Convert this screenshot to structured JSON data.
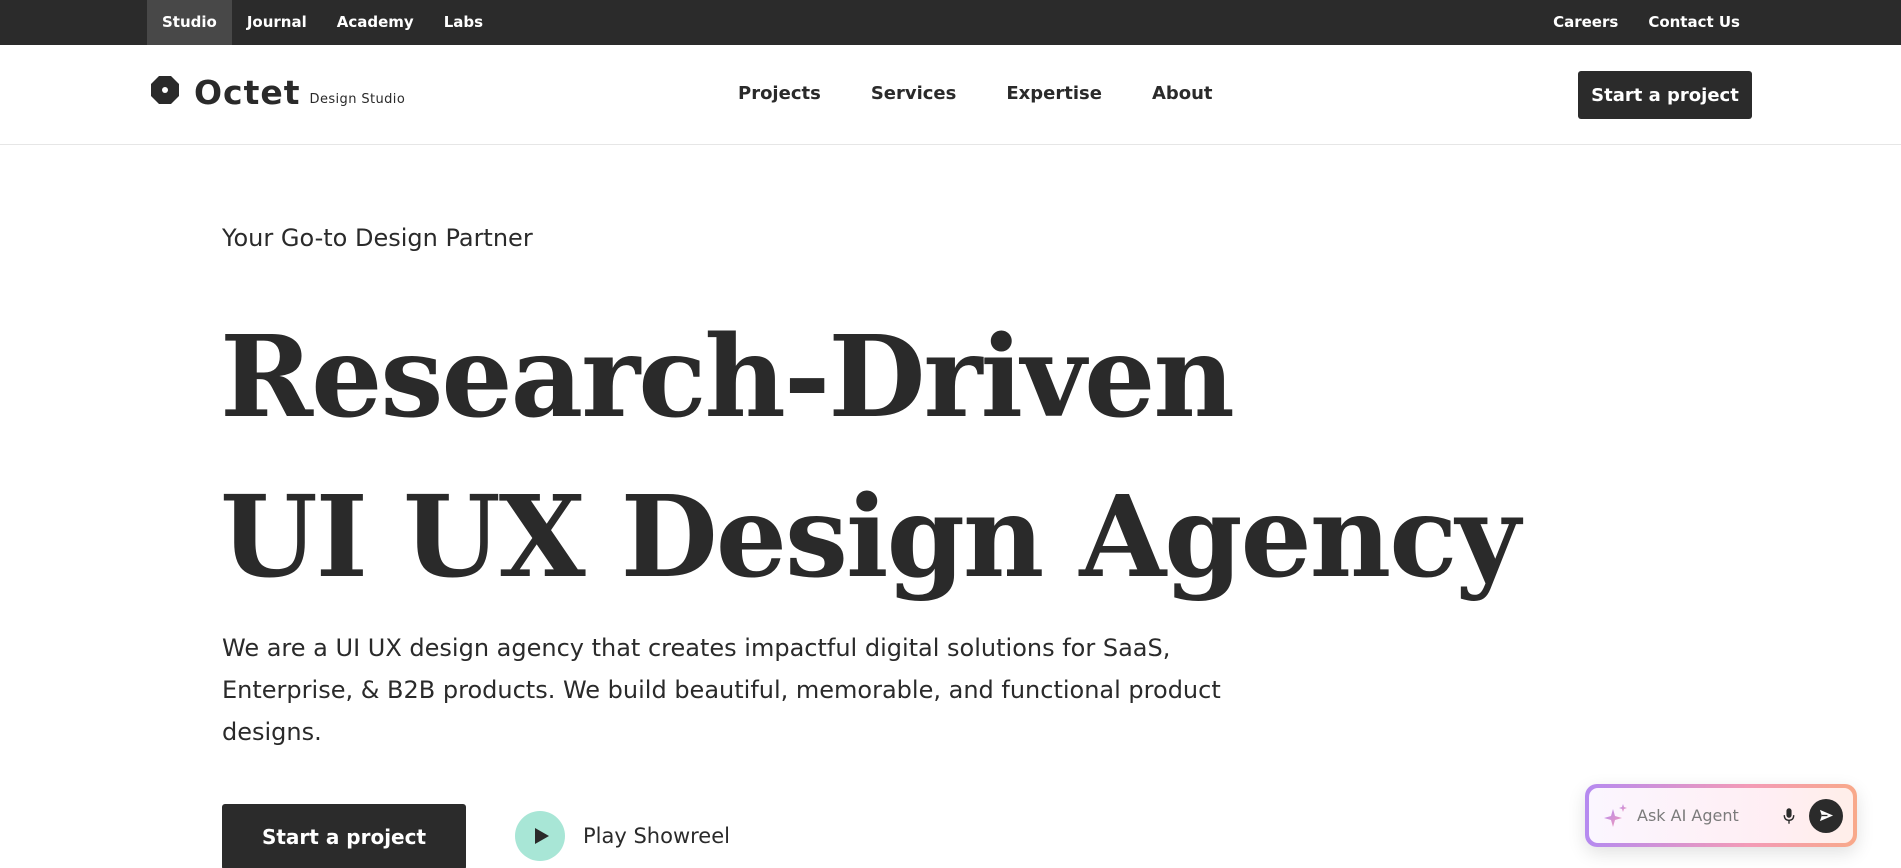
{
  "utility_nav": {
    "left": [
      {
        "label": "Studio",
        "active": true
      },
      {
        "label": "Journal",
        "active": false
      },
      {
        "label": "Academy",
        "active": false
      },
      {
        "label": "Labs",
        "active": false
      }
    ],
    "right": [
      {
        "label": "Careers"
      },
      {
        "label": "Contact Us"
      }
    ]
  },
  "header": {
    "logo_text": "Octet",
    "logo_sub": "Design Studio",
    "logo_icon": "octagon-logo-icon",
    "nav": [
      {
        "label": "Projects"
      },
      {
        "label": "Services"
      },
      {
        "label": "Expertise"
      },
      {
        "label": "About"
      }
    ],
    "cta_label": "Start a project"
  },
  "hero": {
    "eyebrow": "Your Go-to Design Partner",
    "title_lines": [
      "Research-Driven",
      "UI UX Design Agency"
    ],
    "description": "We are a UI UX design agency that creates impactful digital solutions for SaaS, Enterprise, & B2B products. We build beautiful, memorable, and functional product designs.",
    "cta_label": "Start a project",
    "showreel_label": "Play Showreel",
    "showreel_icon": "play-icon"
  },
  "ai_agent": {
    "placeholder": "Ask AI Agent",
    "sparkle_icon": "sparkle-icon",
    "mic_icon": "mic-icon",
    "send_icon": "send-icon"
  },
  "colors": {
    "dark": "#2b2b2b",
    "utility_active": "#484848",
    "play_accent": "#a8e6d6",
    "ai_gradient_start": "#b58af0",
    "ai_gradient_end": "#f8a98a"
  }
}
